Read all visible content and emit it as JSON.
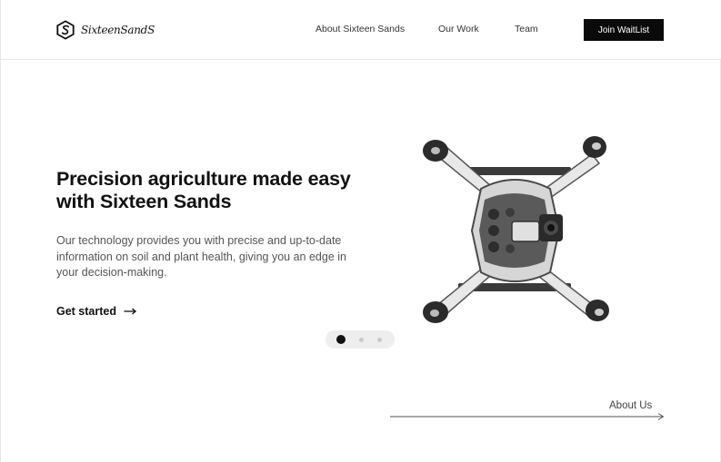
{
  "header": {
    "logo_text": "SixteenSandS",
    "nav": [
      {
        "label": "About Sixteen Sands"
      },
      {
        "label": "Our Work"
      },
      {
        "label": "Team"
      }
    ],
    "cta_label": "Join WaitList"
  },
  "hero": {
    "title": "Precision agriculture made easy with Sixteen Sands",
    "description": "Our technology provides you with precise and up-to-date information on soil and plant health, giving you an edge in your decision-making.",
    "cta_label": "Get started",
    "carousel": {
      "count": 3,
      "active": 1
    }
  },
  "footer_link": {
    "label": "About Us"
  },
  "icons": [
    "logo-hexagon-s-icon",
    "arrow-right-icon",
    "drone-image",
    "long-arrow-right-icon"
  ],
  "colors": {
    "accent": "#0a0a0a",
    "text": "#111111",
    "muted": "#555555",
    "dots_bg": "#eeeeee"
  }
}
